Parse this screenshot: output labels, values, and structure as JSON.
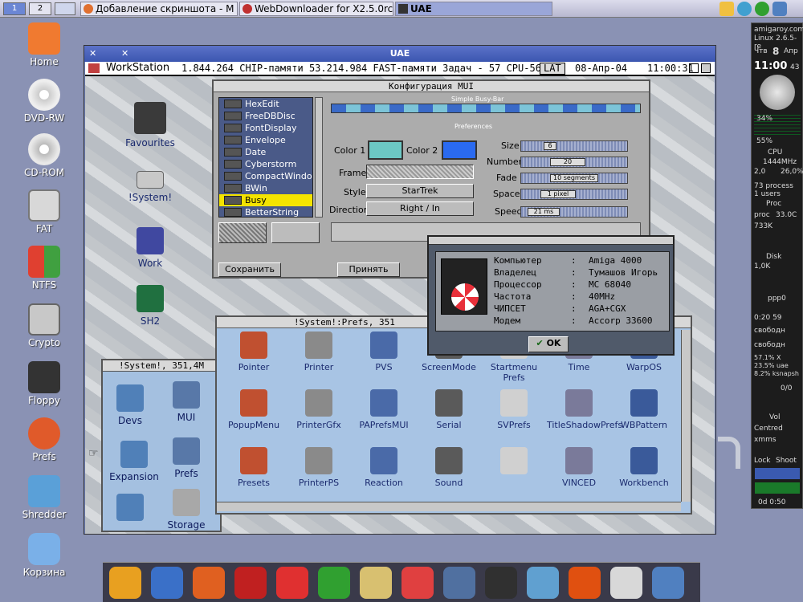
{
  "taskbar": {
    "desktops": [
      "1",
      "2"
    ],
    "tasks": [
      {
        "label": "Добавление скриншота - M"
      },
      {
        "label": "WebDownloader for X2.5.0rc3"
      },
      {
        "label": "UAE"
      }
    ]
  },
  "desktop_icons": [
    {
      "label": "Home",
      "icon": "home-icon"
    },
    {
      "label": "DVD-RW",
      "icon": "dvd-icon"
    },
    {
      "label": "CD-ROM",
      "icon": "cdrom-icon"
    },
    {
      "label": "FAT",
      "icon": "drive-icon"
    },
    {
      "label": "NTFS",
      "icon": "windows-drive-icon"
    },
    {
      "label": "Crypto",
      "icon": "crypto-icon"
    },
    {
      "label": "Floppy",
      "icon": "floppy-icon"
    },
    {
      "label": "Prefs",
      "icon": "prefs-icon"
    },
    {
      "label": "Shredder",
      "icon": "shredder-icon"
    },
    {
      "label": "Корзина",
      "icon": "trash-icon"
    }
  ],
  "uae": {
    "title": "UAE",
    "wb_bar": {
      "name": "WorkStation",
      "info": "1.844.264 CHIP-памяти 53.214.984 FAST-памяти  Задач - 57 CPU-56%",
      "lat": "LAT",
      "date": "08-Апр-04",
      "time": "11:00:31"
    },
    "wb_icons": [
      "Favourites",
      "!System!",
      "Work",
      "SH2"
    ],
    "mui": {
      "title": "Конфигурация MUI",
      "list": [
        "HexEdit",
        "FreeDBDisc",
        "FontDisplay",
        "Envelope",
        "Date",
        "Cyberstorm",
        "CompactWindow",
        "BWin",
        "Busy",
        "BetterString"
      ],
      "selected": "Busy",
      "group_busy": "Simple Busy-Bar",
      "group_prefs": "Preferences",
      "color1_label": "Color 1",
      "color2_label": "Color 2",
      "frame_label": "Frame",
      "style_label": "Style",
      "style_value": "StarTrek",
      "direction_label": "Direction",
      "direction_value": "Right / In",
      "size_label": "Size",
      "size_value": "6",
      "number_label": "Number",
      "number_value": "20",
      "fade_label": "Fade",
      "fade_value": "10 segments",
      "space_label": "Space",
      "space_value": "1 pixel",
      "speed_label": "Speed",
      "speed_value": "21 ms",
      "save_label": "Сохранить",
      "accept_label": "Принять",
      "color1": "#6cc8c4",
      "color2": "#2a6af0"
    },
    "about": {
      "rows": [
        {
          "k": "Компьютер",
          "v": "Amiga 4000"
        },
        {
          "k": "Владелец",
          "v": "Тумашов Игорь"
        },
        {
          "k": "Процессор",
          "v": "MC 68040"
        },
        {
          "k": "Частота",
          "v": "40MHz"
        },
        {
          "k": "ЧИПСЕТ",
          "v": "AGA+CGX"
        },
        {
          "k": "Модем",
          "v": "Accorp 33600"
        }
      ],
      "ok_label": "OK"
    },
    "prefs_window": {
      "title": "!System!:Prefs,  351",
      "icons": [
        "Pointer",
        "Printer",
        "PVS",
        "ScreenMode",
        "Startmenu Prefs",
        "Time",
        "WarpOS",
        "PopupMenu",
        "PrinterGfx",
        "PAPrefsMUI",
        "Serial",
        "SVPrefs",
        "TitleShadowPrefs",
        "WBPattern",
        "Presets",
        "PrinterPS",
        "Reaction",
        "Sound",
        "",
        "VINCED",
        "Workbench"
      ]
    },
    "system_window": {
      "title": "!System!,  351,4M",
      "icons": [
        "Devs",
        "MUI",
        "Expansion",
        "Prefs",
        "",
        "Storage"
      ]
    }
  },
  "right_panel": {
    "host": "amigaroy.com",
    "kernel": "Linux 2.6.5-re",
    "day": "Чтв",
    "date_num": "8",
    "month": "Апр",
    "time": "11:00",
    "seconds": "43",
    "cpu_pct1": "34%",
    "cpu_pct2": "55%",
    "cpu_label": "CPU",
    "cpu_freq": "1444MHz",
    "range_lo": "2,0",
    "range_hi": "26,0%",
    "procs": "73 process",
    "users": "1 users",
    "proc_label": "Proc",
    "proc_temp": "33.0C",
    "mem": "733K",
    "disk_label": "Disk",
    "disk_val": "1,0K",
    "ppp": "ppp0",
    "uptime": "0:20 59",
    "free1": "свободн",
    "free2": "свободн",
    "x_stat": "57.1% X",
    "uae_stat": "23.5% uae",
    "ksnap_stat": "8.2% ksnapsh",
    "mail": "0/0",
    "vol": "Vol",
    "centred": "Centred",
    "xmms": "xmms",
    "lock": "Lock",
    "shoot": "Shoot",
    "clock_small": "0d  0:50"
  },
  "dock": [
    "kde-icon",
    "network-icon",
    "firefox-icon",
    "xchat-dx-icon",
    "xchat-icon",
    "icq-icon",
    "crystal-icon",
    "amiga-ball-icon",
    "mplayer-icon",
    "terminal-icon",
    "weather-icon",
    "fire-icon",
    "clock-icon",
    "lock-icon"
  ]
}
